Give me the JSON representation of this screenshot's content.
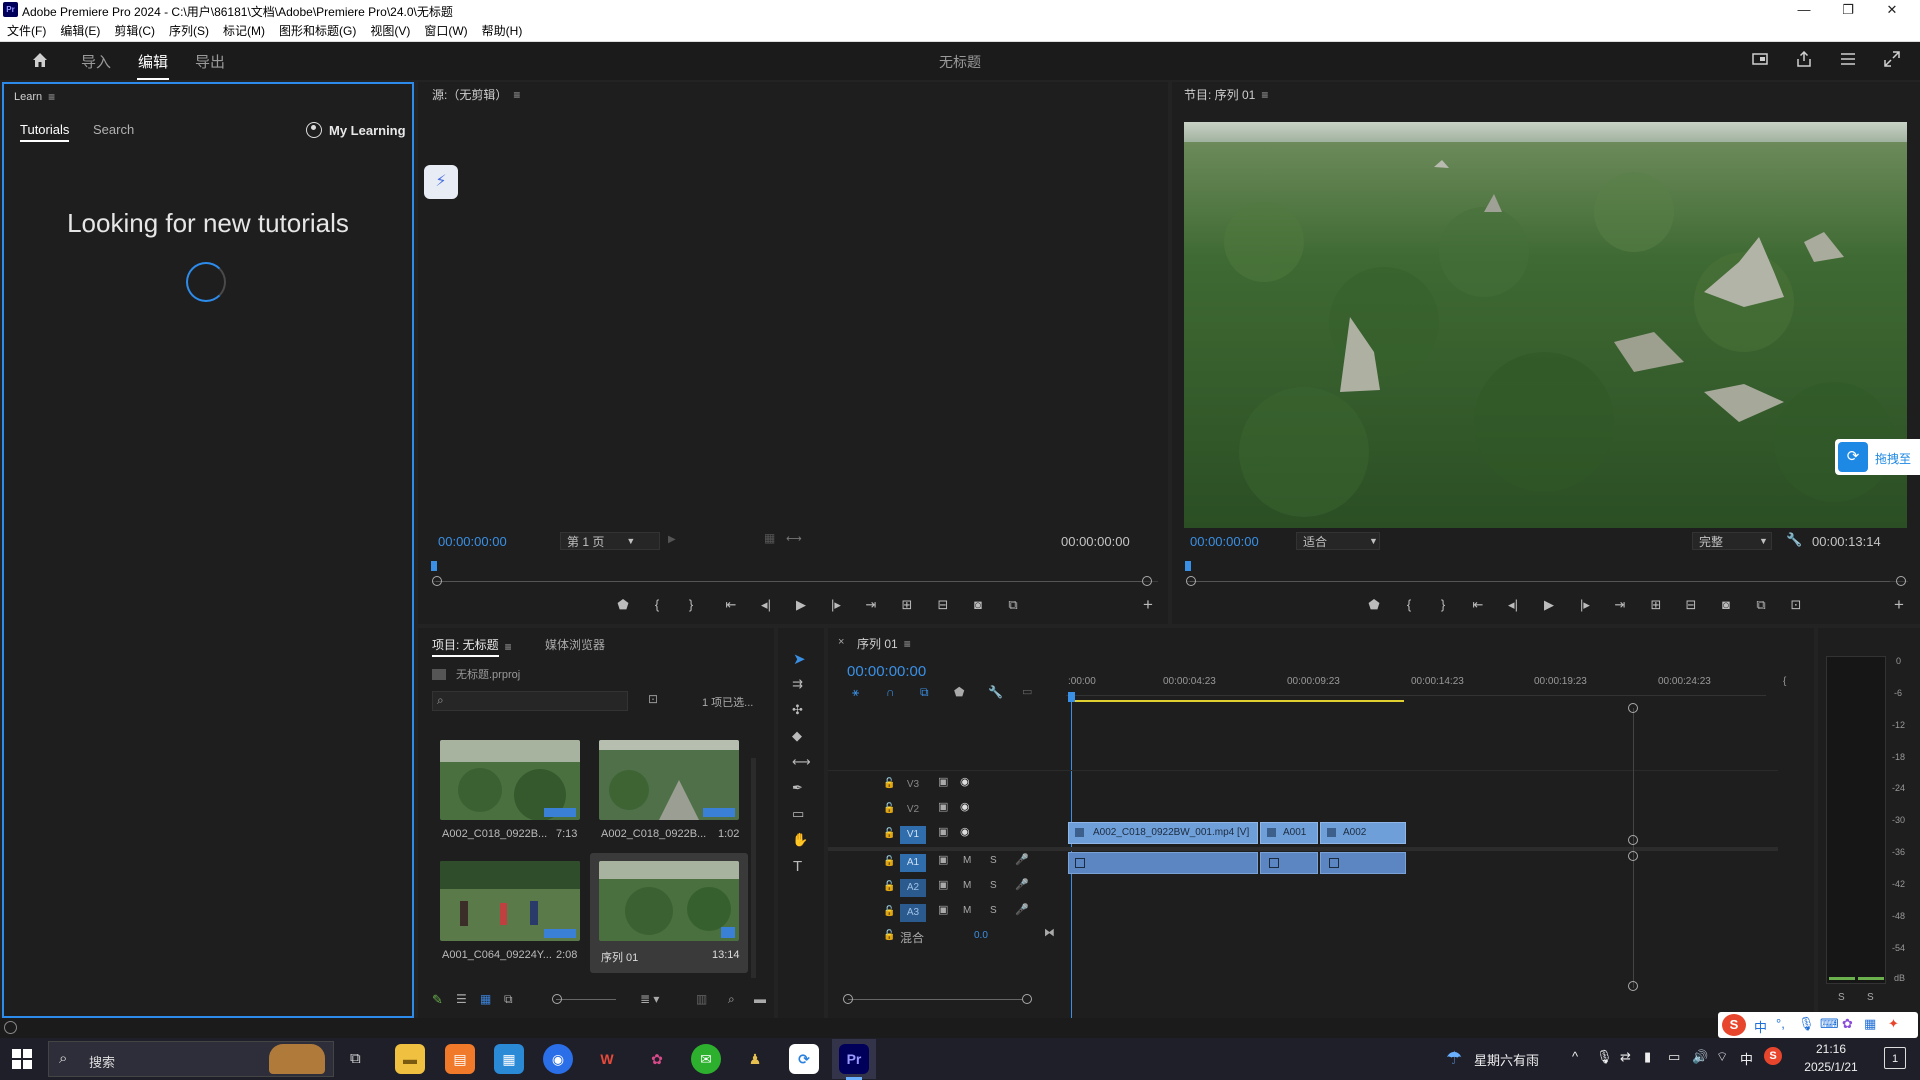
{
  "window": {
    "title": "Adobe Premiere Pro 2024 - C:\\用户\\86181\\文档\\Adobe\\Premiere Pro\\24.0\\无标题",
    "app_icon": "Pr",
    "controls": [
      "—",
      "❐",
      "✕"
    ]
  },
  "menu": [
    "文件(F)",
    "编辑(E)",
    "剪辑(C)",
    "序列(S)",
    "标记(M)",
    "图形和标题(G)",
    "视图(V)",
    "窗口(W)",
    "帮助(H)"
  ],
  "workspace": {
    "tabs": [
      "导入",
      "编辑",
      "导出"
    ],
    "active_tab": "编辑",
    "document_title": "无标题"
  },
  "learn": {
    "header": "Learn",
    "tabs": [
      "Tutorials",
      "Search"
    ],
    "my_learning": "My Learning",
    "message": "Looking for new tutorials"
  },
  "source": {
    "header": "源:（无剪辑）",
    "tc_left": "00:00:00:00",
    "page": "第 1 页",
    "tc_right": "00:00:00:00"
  },
  "program": {
    "header": "节目: 序列 01",
    "tc_left": "00:00:00:00",
    "fit": "适合",
    "quality": "完整",
    "duration": "00:00:13:14",
    "overlay_label": "拖拽至"
  },
  "project": {
    "tabs": [
      "项目: 无标题",
      "媒体浏览器"
    ],
    "file": "无标题.prproj",
    "selected": "1 项已选...",
    "items": [
      {
        "name": "A002_C018_0922B...",
        "duration": "7:13"
      },
      {
        "name": "A002_C018_0922B...",
        "duration": "1:02"
      },
      {
        "name": "A001_C064_09224Y...",
        "duration": "2:08"
      },
      {
        "name": "序列 01",
        "duration": "13:14"
      }
    ]
  },
  "timeline": {
    "tab": "序列 01",
    "timecode": "00:00:00:00",
    "ruler": [
      ":00:00",
      "00:00:04:23",
      "00:00:09:23",
      "00:00:14:23",
      "00:00:19:23",
      "00:00:24:23"
    ],
    "tracks_video": [
      "V3",
      "V2",
      "V1"
    ],
    "tracks_audio": [
      "A1",
      "A2",
      "A3"
    ],
    "mix_label": "混合",
    "mix_value": "0.0",
    "clips": [
      "A002_C018_0922BW_001.mp4 [V]",
      "A001",
      "A002"
    ],
    "mute": "M",
    "solo": "S"
  },
  "meters": {
    "scale": [
      "0",
      "-6",
      "-12",
      "-18",
      "-24",
      "-30",
      "-36",
      "-42",
      "-48",
      "-54",
      "dB"
    ],
    "solo": [
      "S",
      "S"
    ]
  },
  "taskbar": {
    "search": "搜索",
    "weather": "星期六有雨",
    "ime": "中",
    "time": "21:16",
    "date": "2025/1/21",
    "notif": "1"
  },
  "colors": {
    "accent": "#2d8ceb",
    "timecode": "#3a90e5",
    "clip_video": "#6f9fd8",
    "clip_audio": "#5b86c2",
    "playhead": "#3a90e5",
    "track_active": "#2f6dad"
  }
}
